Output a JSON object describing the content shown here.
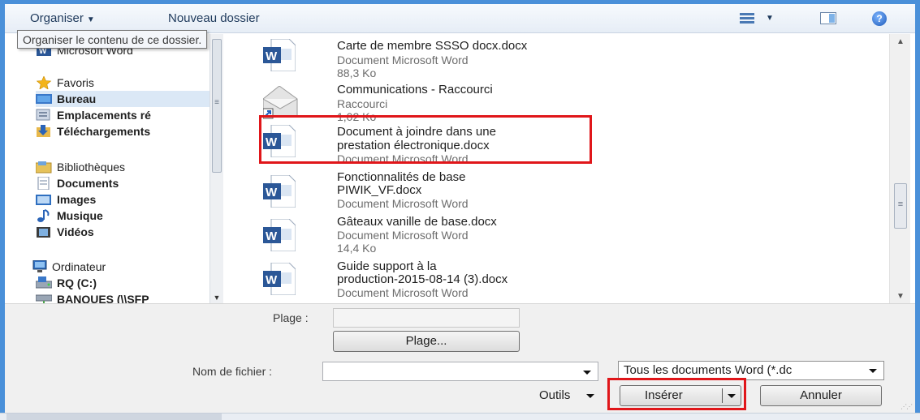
{
  "toolbar": {
    "organise_label": "Organiser",
    "new_folder_label": "Nouveau dossier",
    "tooltip": "Organiser le contenu de ce dossier."
  },
  "nav": {
    "partial_item": "Microsoft Word",
    "favorites": {
      "label": "Favoris",
      "icon": "star-icon"
    },
    "favorite_items": [
      {
        "label": "Bureau",
        "icon": "desktop-icon",
        "selected": true
      },
      {
        "label": "Emplacements ré",
        "icon": "recent-places-icon"
      },
      {
        "label": "Téléchargements",
        "icon": "downloads-icon"
      }
    ],
    "libraries": {
      "label": "Bibliothèques",
      "icon": "library-icon"
    },
    "library_items": [
      {
        "label": "Documents",
        "icon": "documents-icon"
      },
      {
        "label": "Images",
        "icon": "images-icon"
      },
      {
        "label": "Musique",
        "icon": "music-icon"
      },
      {
        "label": "Vidéos",
        "icon": "videos-icon"
      }
    ],
    "computer": {
      "label": "Ordinateur",
      "icon": "computer-icon"
    },
    "computer_items": [
      {
        "label": "RQ (C:)",
        "icon": "drive-icon"
      },
      {
        "label": "BANQUES (\\\\SFP",
        "icon": "network-drive-icon"
      }
    ]
  },
  "files": [
    {
      "name": "Carte de membre SSSO docx.docx",
      "type": "Document Microsoft Word",
      "size": "88,3 Ko",
      "icon": "word-document-icon"
    },
    {
      "name": "Communications - Raccourci",
      "type": "Raccourci",
      "size": "1,02 Ko",
      "icon": "shortcut-envelope-icon"
    },
    {
      "name_line1": "Document à joindre dans une",
      "name_line2": "prestation électronique.docx",
      "type": "Document Microsoft Word",
      "icon": "word-document-icon",
      "highlighted": true
    },
    {
      "name_line1": "Fonctionnalités de base",
      "name_line2": "PIWIK_VF.docx",
      "type": "Document Microsoft Word",
      "icon": "word-document-icon"
    },
    {
      "name": "Gâteaux vanille de base.docx",
      "type": "Document Microsoft Word",
      "size": "14,4 Ko",
      "icon": "word-document-icon"
    },
    {
      "name_line1": "Guide support à la",
      "name_line2": "production-2015-08-14 (3).docx",
      "type": "Document Microsoft Word",
      "icon": "word-document-icon"
    }
  ],
  "bottom": {
    "range_label": "Plage :",
    "range_value": "",
    "range_button": "Plage...",
    "filename_label": "Nom de fichier :",
    "filename_value": "",
    "filetype_value": "Tous les documents Word (*.dc",
    "tools_label": "Outils",
    "insert_button": "Insérer",
    "cancel_button": "Annuler"
  },
  "colors": {
    "highlight": "#e0161a",
    "frame": "#4a90d9",
    "selection": "#dbe8f6"
  }
}
